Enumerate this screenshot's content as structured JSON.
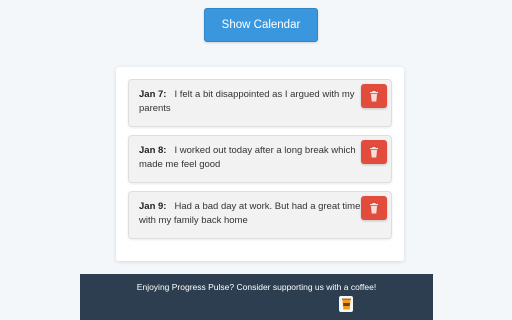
{
  "header": {
    "show_calendar_label": "Show Calendar"
  },
  "entries": [
    {
      "date": "Jan 7:",
      "text": "I felt a bit disappointed as I argued with my parents",
      "delete_icon": "trash-icon"
    },
    {
      "date": "Jan 8:",
      "text": "I worked out today after a long break which made me feel good",
      "delete_icon": "trash-icon"
    },
    {
      "date": "Jan 9:",
      "text": "Had a bad day at work. But had a great time with my family back home",
      "delete_icon": "trash-icon"
    }
  ],
  "footer": {
    "message": "Enjoying Progress Pulse? Consider supporting us with a coffee!",
    "coffee_icon": "coffee-cup-icon"
  },
  "colors": {
    "primary": "#3a97dd",
    "danger": "#e24c3c",
    "footer_bg": "#2c3e50",
    "page_bg": "#f3f7fa"
  }
}
